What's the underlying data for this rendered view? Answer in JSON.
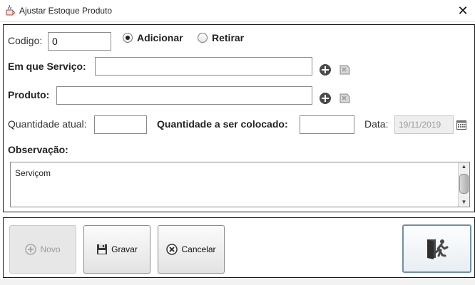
{
  "window": {
    "title": "Ajustar Estoque Produto",
    "icon": "java-coffee-icon",
    "close_label": "✕"
  },
  "form": {
    "codigo_label": "Codigo:",
    "codigo_value": "0",
    "radio_adicionar": {
      "label": "Adicionar",
      "selected": true
    },
    "radio_retirar": {
      "label": "Retirar",
      "selected": false
    },
    "servico_label": "Em que Serviço:",
    "servico_value": "",
    "produto_label": "Produto:",
    "produto_value": "",
    "qtd_atual_label": "Quantidade atual:",
    "qtd_atual_value": "",
    "qtd_colocado_label": "Quantidade a ser colocado:",
    "qtd_colocado_value": "",
    "data_label": "Data:",
    "data_value": "19/11/2019",
    "observacao_label": "Observação:",
    "observacao_value": "Serviçom"
  },
  "icons": {
    "add": "plus-circle-icon",
    "clear": "eraser-icon",
    "calendar": "calendar-icon",
    "save": "floppy-disk-icon",
    "cancel": "cancel-circle-icon",
    "exit": "exit-door-icon"
  },
  "buttons": {
    "novo": {
      "label": "Novo",
      "enabled": false
    },
    "gravar": {
      "label": "Gravar",
      "enabled": true
    },
    "cancelar": {
      "label": "Cancelar",
      "enabled": true
    },
    "sair": {
      "enabled": true
    }
  },
  "colors": {
    "panel_border": "#1a1a1a",
    "disabled_field": "#eeeeee",
    "exit_border": "#6e8fa8"
  }
}
